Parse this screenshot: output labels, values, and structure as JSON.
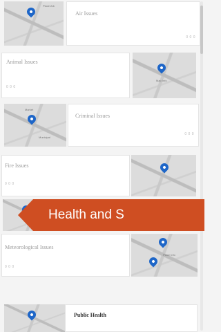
{
  "items": [
    {
      "title": "Air Issues",
      "meta": "0 0 0",
      "map_label": "Place Ark"
    },
    {
      "title": "Animal Issues",
      "meta": "0 0 0",
      "map_label": "Map Info"
    },
    {
      "title": "Criminal Issues",
      "meta": "0 0 0",
      "map_label_1": "Market",
      "map_label_2": "Municipal"
    },
    {
      "title": "Fire Issues",
      "meta": "0 0 0"
    },
    {
      "title": "Health and Safety Issues"
    },
    {
      "title": "Meteorological Issues",
      "meta": "0 0 0",
      "map_label": "Place Info"
    },
    {
      "title": "Public Health"
    }
  ],
  "banner": {
    "label": "Health and S",
    "color": "#cf4e22"
  },
  "colors": {
    "pin": "#1e66c8",
    "accent": "#cf4e22"
  },
  "icons": {
    "pin": "map-pin-icon"
  }
}
